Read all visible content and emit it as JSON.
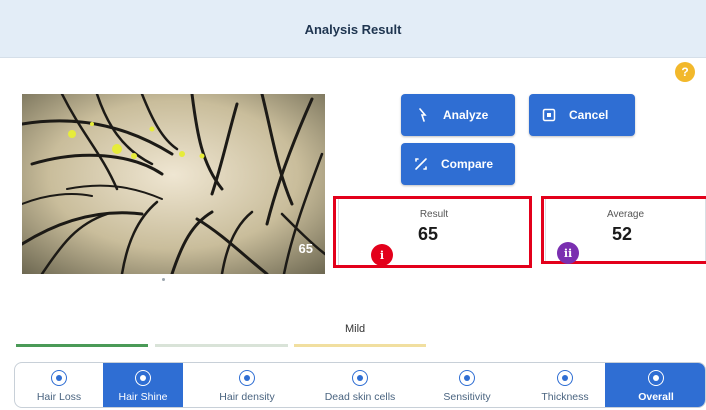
{
  "header": {
    "title": "Analysis Result"
  },
  "help_icon": "?",
  "image": {
    "score": "65"
  },
  "buttons": {
    "analyze": "Analyze",
    "cancel": "Cancel",
    "compare": "Compare"
  },
  "result": {
    "label": "Result",
    "value": "65"
  },
  "average": {
    "label": "Average",
    "value": "52"
  },
  "markers": {
    "first": "i",
    "second": "ii"
  },
  "level": {
    "label": "Mild"
  },
  "tabs": [
    {
      "label": "Hair Loss",
      "icon": "hair-loss-icon"
    },
    {
      "label": "Hair Shine",
      "icon": "hair-shine-icon"
    },
    {
      "label": "Hair density",
      "icon": "hair-density-icon"
    },
    {
      "label": "Dead skin cells",
      "icon": "dead-skin-cells-icon"
    },
    {
      "label": "Sensitivity",
      "icon": "sensitivity-icon"
    },
    {
      "label": "Thickness",
      "icon": "thickness-icon"
    },
    {
      "label": "Overall",
      "icon": "overall-icon"
    }
  ],
  "active_tab": "Hair Shine",
  "colors": {
    "accent": "#2f6ed3",
    "highlight": "#e3001b",
    "marker_two": "#7a2fb0",
    "level_bar_1": "#4a9a57",
    "level_bar_2": "#d9e3d8",
    "level_bar_3": "#f1dfa0"
  }
}
